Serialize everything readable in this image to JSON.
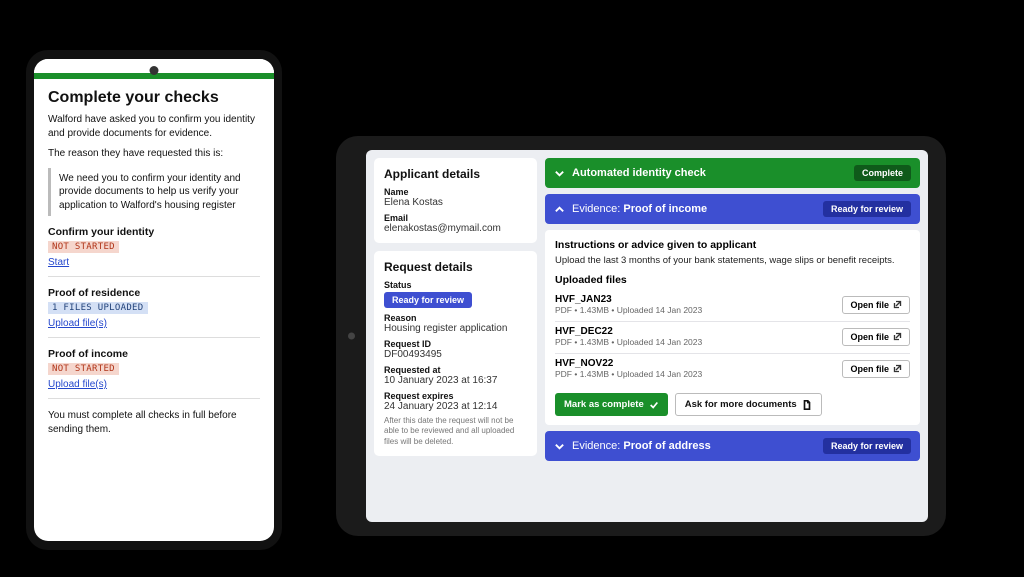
{
  "phone": {
    "title": "Complete your checks",
    "intro": "Walford have asked you to confirm you identity and provide documents for evidence.",
    "reason_label": "The reason they have requested this is:",
    "reason_body": "We need you to confirm your identity and provide documents to help us verify your application to Walford's housing register",
    "tasks": [
      {
        "title": "Confirm your identity",
        "status": "NOT STARTED",
        "status_variant": "red",
        "action": "Start"
      },
      {
        "title": "Proof of residence",
        "status": "1 FILES UPLOADED",
        "status_variant": "blue",
        "action": "Upload file(s)"
      },
      {
        "title": "Proof of income",
        "status": "NOT STARTED",
        "status_variant": "red",
        "action": "Upload file(s)"
      }
    ],
    "footer_note": "You must complete all checks in full before sending them."
  },
  "tablet": {
    "left": {
      "applicant_heading": "Applicant details",
      "name_label": "Name",
      "name_value": "Elena Kostas",
      "email_label": "Email",
      "email_value": "elenakostas@mymail.com",
      "request_heading": "Request details",
      "status_label": "Status",
      "status_value": "Ready for review",
      "reason_label": "Reason",
      "reason_value": "Housing register application",
      "request_id_label": "Request ID",
      "request_id_value": "DF00493495",
      "requested_at_label": "Requested at",
      "requested_at_value": "10 January 2023 at 16:37",
      "expires_label": "Request expires",
      "expires_value": "24 January 2023 at 12:14",
      "expires_note": "After this date the request will not be able to be reviewed and all uploaded files will be deleted."
    },
    "accordions": {
      "identity": {
        "title": "Automated identity check",
        "status": "Complete"
      },
      "income": {
        "prefix": "Evidence:",
        "title": "Proof of income",
        "status": "Ready for review"
      },
      "address": {
        "prefix": "Evidence:",
        "title": "Proof of address",
        "status": "Ready for review"
      }
    },
    "income_panel": {
      "instructions_heading": "Instructions or advice given to applicant",
      "instructions_body": "Upload the last 3 months of your bank statements, wage slips or benefit receipts.",
      "files_heading": "Uploaded files",
      "open_label": "Open file",
      "files": [
        {
          "name": "HVF_JAN23",
          "meta": "PDF • 1.43MB • Uploaded 14 Jan 2023"
        },
        {
          "name": "HVF_DEC22",
          "meta": "PDF • 1.43MB • Uploaded 14 Jan 2023"
        },
        {
          "name": "HVF_NOV22",
          "meta": "PDF • 1.43MB • Uploaded 14 Jan 2023"
        }
      ],
      "mark_complete": "Mark as complete",
      "ask_more": "Ask for more documents"
    }
  }
}
